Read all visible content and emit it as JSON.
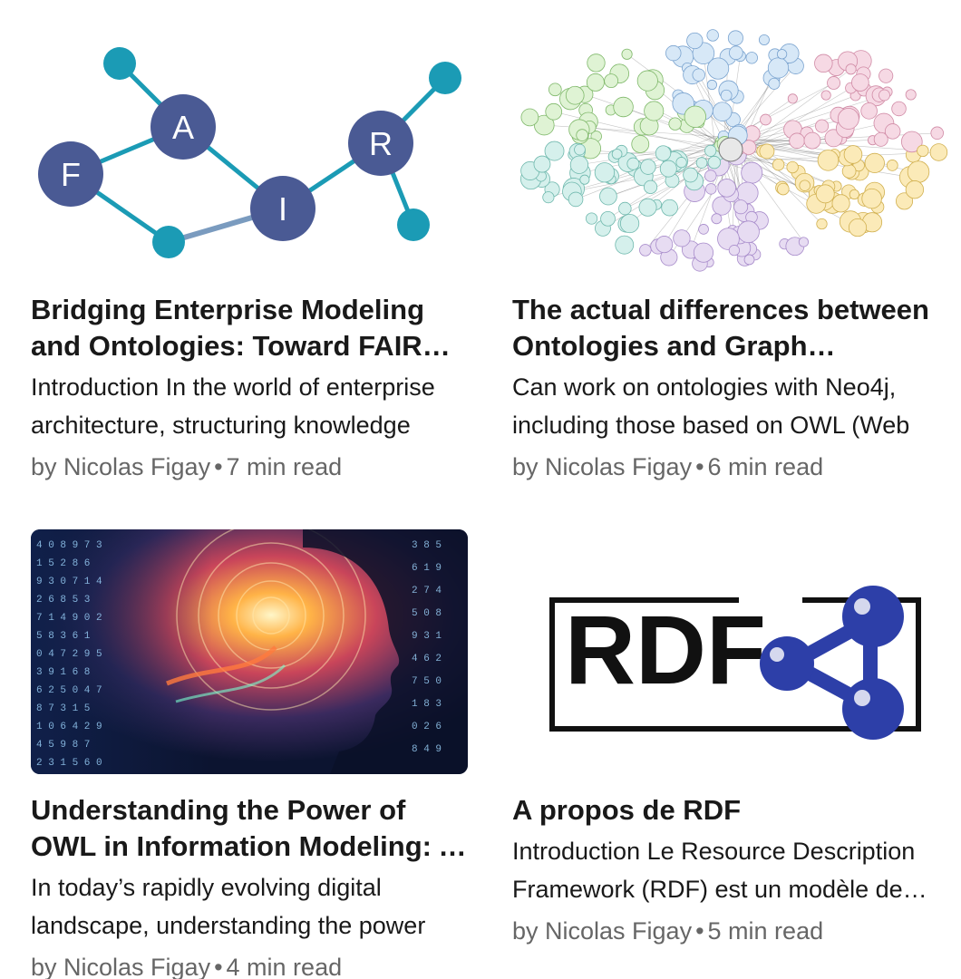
{
  "articles": [
    {
      "title": "Bridging Enterprise Modeling and Ontologies: Toward FAIR Enterprise Models",
      "excerpt": "Introduction In the world of enterprise architecture, structuring knowledge",
      "author": "by Nicolas Figay",
      "read_time": "7 min read",
      "image_icon": "fair-graph-logo",
      "image_letters": [
        "F",
        "A",
        "I",
        "R"
      ]
    },
    {
      "title": "The actual differences between Ontologies and Graph databases",
      "excerpt": "Can work on ontologies with Neo4j, including those based on OWL (Web",
      "author": "by Nicolas Figay",
      "read_time": "6 min read",
      "image_icon": "linked-open-data-cloud"
    },
    {
      "title": "Understanding the Power of OWL in Information Modeling: A Guide",
      "excerpt": "In today’s rapidly evolving digital landscape, understanding the power",
      "author": "by Nicolas Figay",
      "read_time": "4 min read",
      "image_icon": "digital-mind-illustration"
    },
    {
      "title": "A propos de RDF",
      "excerpt": "Introduction Le Resource Description Framework (RDF) est un modèle de données",
      "author": "by Nicolas Figay",
      "read_time": "5 min read",
      "image_icon": "rdf-logo",
      "image_text": "RDF"
    }
  ],
  "separator": "•",
  "colors": {
    "fair_node": "#4a5a94",
    "fair_dot": "#1b9bb5",
    "rdf_blue": "#2d3fa8",
    "meta_text": "#666666"
  }
}
